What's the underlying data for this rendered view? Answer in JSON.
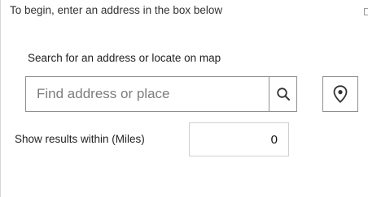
{
  "header": {
    "instruction_text": "To begin, enter an address in the box below"
  },
  "search": {
    "label": "Search for an address or locate on map",
    "placeholder": "Find address or place",
    "value": "",
    "search_icon": "search-icon",
    "locate_icon": "location-pin-icon"
  },
  "radius": {
    "label": "Show results within (Miles)",
    "value": "0"
  }
}
